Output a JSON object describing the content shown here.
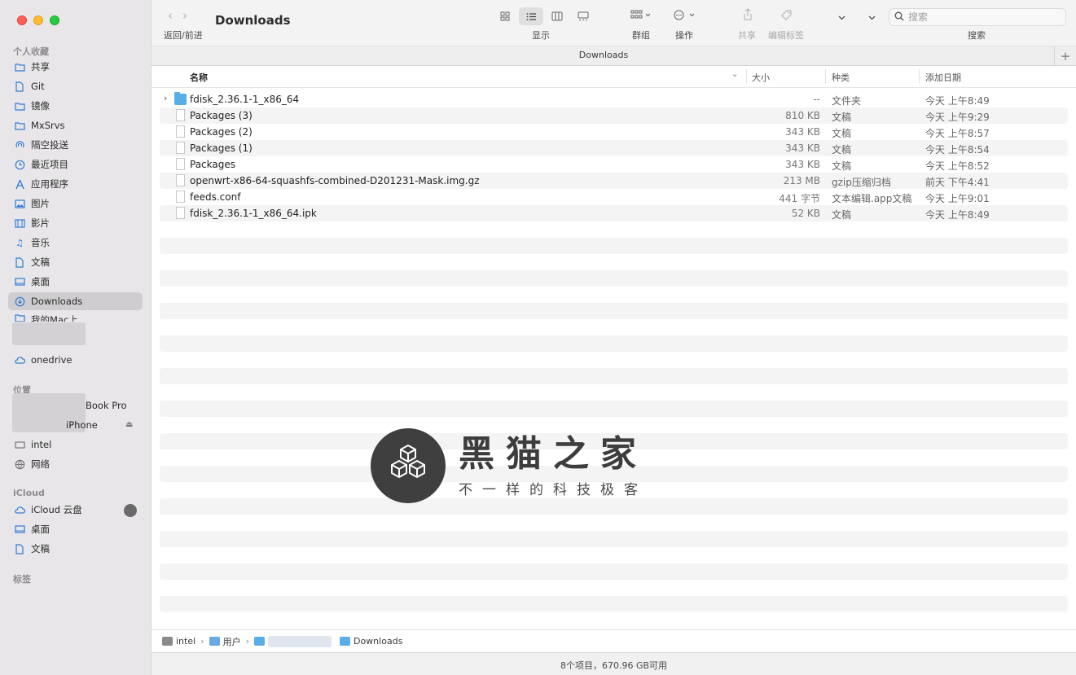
{
  "window": {
    "title": "Downloads",
    "tab_title": "Downloads"
  },
  "toolbar": {
    "nav_label": "返回/前进",
    "view_label": "显示",
    "group_label": "群组",
    "action_label": "操作",
    "share_label": "共享",
    "tags_label": "编辑标签",
    "search_label": "搜索",
    "search_placeholder": "搜索"
  },
  "sidebar": {
    "favorites_heading": "个人收藏",
    "favorites": [
      {
        "label": "共享",
        "icon": "folder-icon"
      },
      {
        "label": "Git",
        "icon": "document-icon"
      },
      {
        "label": "镜像",
        "icon": "folder-icon"
      },
      {
        "label": "MxSrvs",
        "icon": "folder-icon"
      },
      {
        "label": "隔空投送",
        "icon": "airdrop-icon"
      },
      {
        "label": "最近项目",
        "icon": "clock-icon"
      },
      {
        "label": "应用程序",
        "icon": "applications-icon"
      },
      {
        "label": "图片",
        "icon": "photo-icon"
      },
      {
        "label": "影片",
        "icon": "film-icon"
      },
      {
        "label": "音乐",
        "icon": "music-icon"
      },
      {
        "label": "文稿",
        "icon": "document-icon"
      },
      {
        "label": "桌面",
        "icon": "desktop-icon"
      },
      {
        "label": "Downloads",
        "icon": "download-icon"
      },
      {
        "label": "我的Mac上",
        "icon": "folder-icon"
      }
    ],
    "onedrive_label": "onedrive",
    "locations_heading": "位置",
    "locations": [
      {
        "label": "Book Pro",
        "icon": "laptop-icon"
      },
      {
        "label": "iPhone",
        "icon": "phone-icon"
      },
      {
        "label": "intel",
        "icon": "disk-icon"
      },
      {
        "label": "网络",
        "icon": "network-icon"
      }
    ],
    "icloud_heading": "iCloud",
    "icloud": [
      {
        "label": "iCloud 云盘",
        "icon": "cloud-icon"
      },
      {
        "label": "桌面",
        "icon": "desktop-icon"
      },
      {
        "label": "文稿",
        "icon": "document-icon"
      }
    ],
    "tags_heading": "标签",
    "active_item": "Downloads"
  },
  "columns": {
    "name": "名称",
    "size": "大小",
    "kind": "种类",
    "date": "添加日期"
  },
  "files": [
    {
      "name": "fdisk_2.36.1-1_x86_64",
      "size": "--",
      "kind": "文件夹",
      "date": "今天 上午8:49",
      "type": "folder"
    },
    {
      "name": "Packages (3)",
      "size": "810 KB",
      "kind": "文稿",
      "date": "今天 上午9:29",
      "type": "document"
    },
    {
      "name": "Packages (2)",
      "size": "343 KB",
      "kind": "文稿",
      "date": "今天 上午8:57",
      "type": "document"
    },
    {
      "name": "Packages (1)",
      "size": "343 KB",
      "kind": "文稿",
      "date": "今天 上午8:54",
      "type": "document"
    },
    {
      "name": "Packages",
      "size": "343 KB",
      "kind": "文稿",
      "date": "今天 上午8:52",
      "type": "document"
    },
    {
      "name": "openwrt-x86-64-squashfs-combined-D201231-Mask.img.gz",
      "size": "213 MB",
      "kind": "gzip压缩归档",
      "date": "前天 下午4:41",
      "type": "archive"
    },
    {
      "name": "feeds.conf",
      "size": "441 字节",
      "kind": "文本编辑.app文稿",
      "date": "今天 上午9:01",
      "type": "document"
    },
    {
      "name": "fdisk_2.36.1-1_x86_64.ipk",
      "size": "52 KB",
      "kind": "文稿",
      "date": "今天 上午8:49",
      "type": "document"
    }
  ],
  "watermark": {
    "title": "黑猫之家",
    "subtitle": "不一样的科技极客"
  },
  "pathbar": {
    "segments": [
      "intel",
      "用户",
      "Downloads"
    ]
  },
  "status": {
    "text": "8个项目，670.96 GB可用"
  }
}
